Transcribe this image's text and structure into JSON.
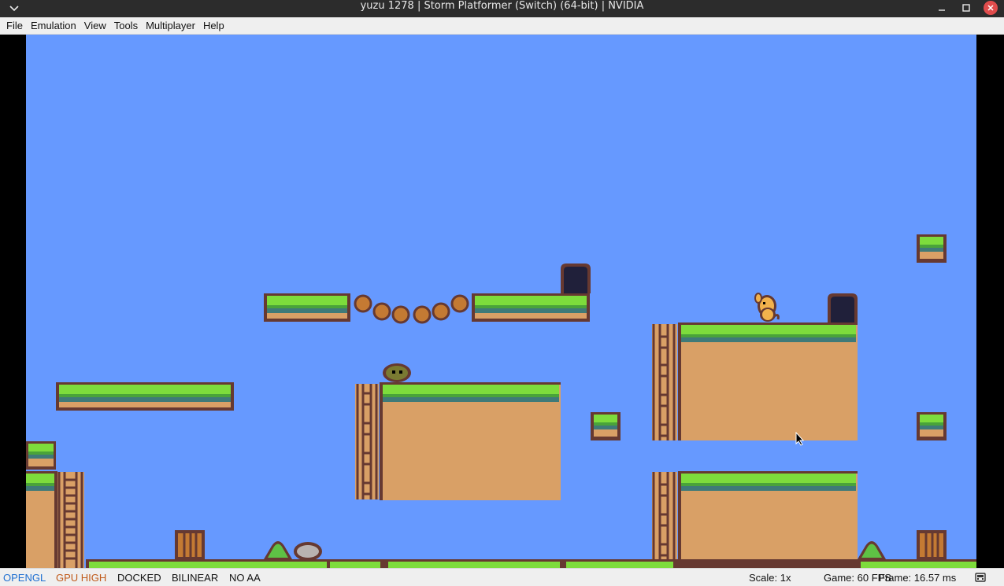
{
  "window": {
    "title": "yuzu 1278 | Storm Platformer (Switch) (64-bit) | NVIDIA",
    "controls": [
      "minimize-icon",
      "maximize-icon",
      "close-icon"
    ]
  },
  "menu": {
    "file": "File",
    "emulation": "Emulation",
    "view": "View",
    "tools": "Tools",
    "multiplayer": "Multiplayer",
    "help": "Help"
  },
  "game": {
    "sky_color": "#6699ff",
    "grass_color": "#7ddc3c",
    "dirt_color": "#d9a066",
    "outline_color": "#663931",
    "player_color": "#f2b24c"
  },
  "status": {
    "api": "OPENGL",
    "gpu_accuracy": "GPU HIGH",
    "mode": "DOCKED",
    "filter": "BILINEAR",
    "aa": "NO AA",
    "scale": "Scale: 1x",
    "fps": "Game: 60 FPS",
    "frame": "Frame: 16.57 ms",
    "colors": {
      "api": "#1e6fd1",
      "gpu": "#c05a1a"
    }
  }
}
